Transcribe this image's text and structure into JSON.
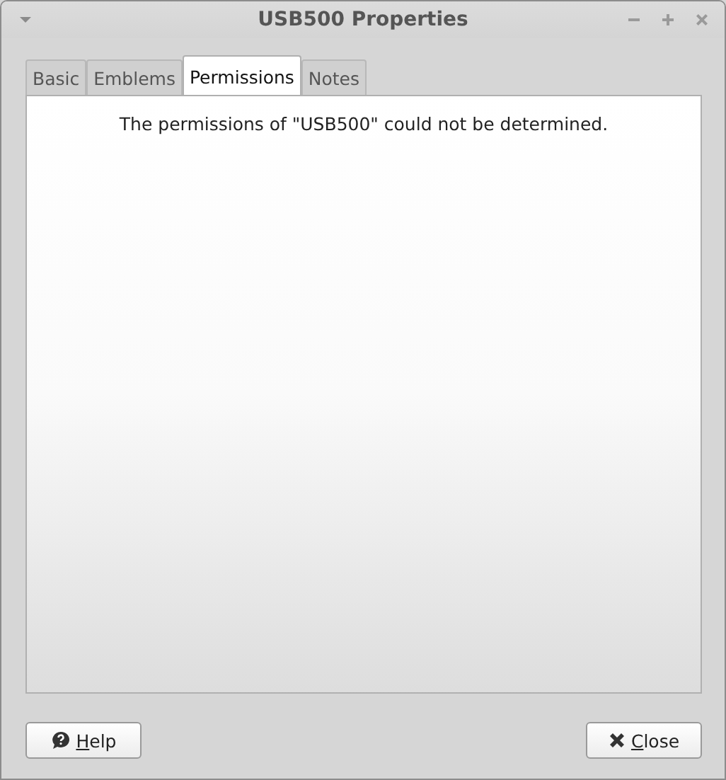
{
  "window": {
    "title": "USB500 Properties"
  },
  "tabs": [
    {
      "label": "Basic",
      "selected": false
    },
    {
      "label": "Emblems",
      "selected": false
    },
    {
      "label": "Permissions",
      "selected": true
    },
    {
      "label": "Notes",
      "selected": false
    }
  ],
  "message": "The permissions of \"USB500\" could not be determined.",
  "buttons": [
    {
      "kind": "help",
      "label": "Help",
      "mnemonic": true
    },
    {
      "kind": "close",
      "label": "Close",
      "mnemonic": true
    }
  ]
}
